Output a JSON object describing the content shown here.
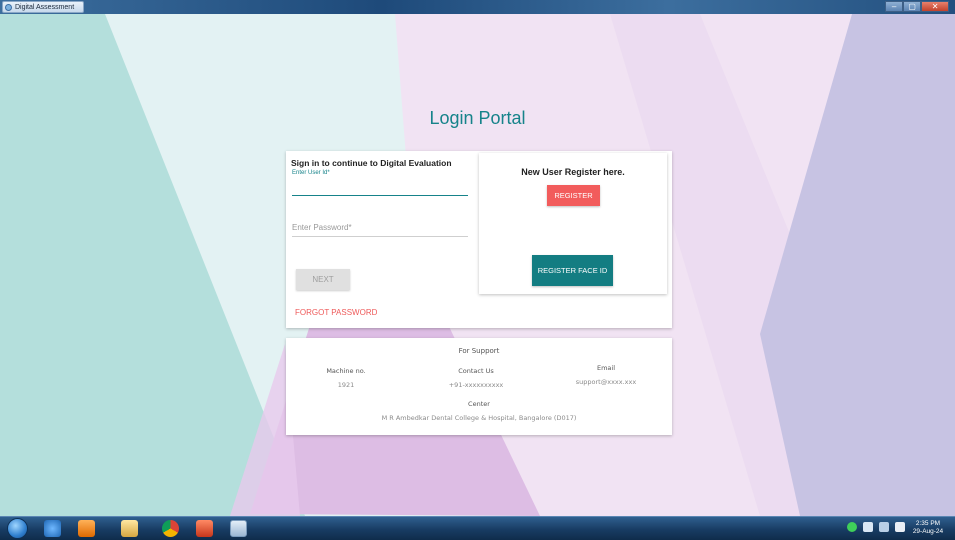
{
  "window": {
    "title": "Digital Assessment",
    "controls": [
      "–",
      "▢",
      "✕"
    ]
  },
  "login": {
    "title": "Login Portal",
    "signin_heading": "Sign in to continue to Digital Evaluation",
    "userid_label": "Enter User Id*",
    "password_placeholder": "Enter Password*",
    "next_label": "NEXT",
    "forgot_label": "FORGOT PASSWORD"
  },
  "register": {
    "heading": "New User Register here.",
    "register_label": "REGISTER",
    "face_label": "REGISTER FACE ID"
  },
  "support": {
    "title": "For Support",
    "machine_label": "Machine no.",
    "machine_value": "1921",
    "contact_label": "Contact Us",
    "contact_value": "+91-xxxxxxxxxx",
    "email_label": "Email",
    "email_value": "support@xxxx.xxx",
    "center_label": "Center",
    "center_value": "M R Ambedkar Dental College & Hospital, Bangalore (D017)"
  },
  "taskbar": {
    "time": "2:35 PM",
    "date": "29-Aug-24"
  },
  "colors": {
    "accent": "#16838a",
    "danger": "#f25c5c",
    "face_button": "#137d82",
    "disabled": "#e0e0e0"
  },
  "icons": {
    "taskbar": [
      "start-orb",
      "internet-explorer-icon",
      "media-player-icon",
      "file-explorer-icon",
      "chrome-icon",
      "pdf-reader-icon",
      "app-icon"
    ],
    "tray": [
      "network-icon",
      "volume-icon",
      "display-icon",
      "flag-icon"
    ]
  }
}
